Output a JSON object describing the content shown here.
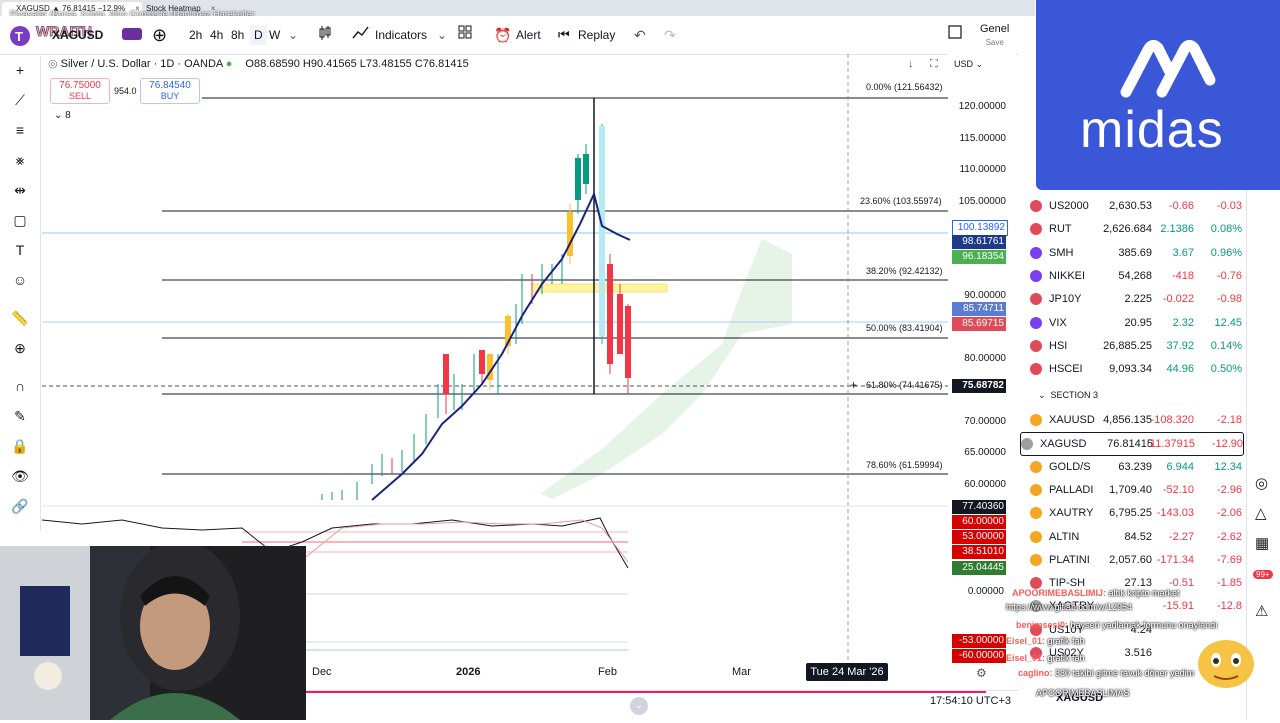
{
  "browser": {
    "tabs": [
      {
        "label": "XAGUSD ▲ 76.81415 −12.9%"
      },
      {
        "label": "Stock Heatmap"
      }
    ]
  },
  "overlay_text": "Piyasalar (Borsa, Kripto, Altın Gümüş'te (Hanlimaz Hareketler",
  "toolbar": {
    "symbol": "XAGUSD",
    "intervals": [
      "2h",
      "4h",
      "8h",
      "D",
      "W"
    ],
    "indicators": "Indicators",
    "alert": "Alert",
    "replay": "Replay",
    "layout_name": "Genel",
    "layout_sub": "Save"
  },
  "legend": {
    "title": "Silver / U.S. Dollar · 1D · OANDA",
    "open": "O88.68590",
    "high": "H90.41565",
    "low": "L73.48155",
    "close": "C76.81415",
    "sell_price": "76.75000",
    "sell_label": "SELL",
    "spread": "954.0",
    "buy_price": "76.84540",
    "buy_label": "BUY",
    "collapse_count": "8"
  },
  "price_axis": {
    "currency": "USD",
    "ticks": [
      "120.00000",
      "115.00000",
      "110.00000",
      "105.00000",
      "100.00000",
      "95.00000",
      "90.00000",
      "85.00000",
      "80.00000",
      "75.00000",
      "70.00000",
      "65.00000",
      "60.00000"
    ],
    "labels": [
      {
        "value": "100.13892",
        "color": "#ffffff",
        "text_color": "#2962ff"
      },
      {
        "value": "98.61761",
        "color": "#1e3a8a"
      },
      {
        "value": "96.18354",
        "color": "#4caf50"
      },
      {
        "value": "85.74711",
        "color": "#5b7bd5"
      },
      {
        "value": "85.69715",
        "color": "#e04b5a"
      },
      {
        "value": "75.68782",
        "color": "#131722"
      }
    ],
    "osc_labels": [
      {
        "value": "77.40360",
        "color": "#131722"
      },
      {
        "value": "60.00000",
        "color": "#d50000"
      },
      {
        "value": "53.00000",
        "color": "#d50000"
      },
      {
        "value": "38.51010",
        "color": "#d50000"
      },
      {
        "value": "25.04445",
        "color": "#2e7d32"
      },
      {
        "value": "0.00000",
        "color": "#ffffff",
        "text_color": "#131722"
      },
      {
        "value": "-53.00000",
        "color": "#d50000"
      },
      {
        "value": "-60.00000",
        "color": "#d50000"
      }
    ]
  },
  "fib": [
    {
      "label": "0.00% (121.56432)"
    },
    {
      "label": "23.60% (103.55974)"
    },
    {
      "label": "38.20% (92.42132)"
    },
    {
      "label": "50.00% (83.41904)"
    },
    {
      "label": "61.80% (74.41675)"
    },
    {
      "label": "78.60% (61.59994)"
    }
  ],
  "time_axis": {
    "labels": [
      "Dec",
      "2026",
      "Feb",
      "Mar"
    ],
    "crosshair": "Tue 24 Mar '26"
  },
  "clock": "17:54:10 UTC+3",
  "watchlist": {
    "rows": [
      {
        "sym": "US2000",
        "last": "2,630.53",
        "chg": "-0.66",
        "pct": "-0.03",
        "color": "#e04b5a"
      },
      {
        "sym": "RUT",
        "last": "2,626.684",
        "chg": "2.1386",
        "pct": "0.08%",
        "color": "#e04b5a"
      },
      {
        "sym": "SMH",
        "last": "385.69",
        "chg": "3.67",
        "pct": "0.96%",
        "color": "#7b3ff2"
      },
      {
        "sym": "NIKKEI",
        "last": "54,268",
        "chg": "-418",
        "pct": "-0.76",
        "color": "#7b3ff2"
      },
      {
        "sym": "JP10Y",
        "last": "2.225",
        "chg": "-0.022",
        "pct": "-0.98",
        "color": "#e04b5a"
      },
      {
        "sym": "VIX",
        "last": "20.95",
        "chg": "2.32",
        "pct": "12.45",
        "color": "#7b3ff2"
      },
      {
        "sym": "HSI",
        "last": "26,885.25",
        "chg": "37.92",
        "pct": "0.14%",
        "color": "#e04b5a"
      },
      {
        "sym": "HSCEI",
        "last": "9,093.34",
        "chg": "44.96",
        "pct": "0.50%",
        "color": "#e04b5a"
      }
    ],
    "section": "SECTION 3",
    "rows2": [
      {
        "sym": "XAUUSD",
        "last": "4,856.135",
        "chg": "-108.320",
        "pct": "-2.18",
        "color": "#f5a623"
      },
      {
        "sym": "XAGUSD",
        "last": "76.81415",
        "chg": "-11.37915",
        "pct": "-12.90",
        "color": "#9e9e9e"
      },
      {
        "sym": "GOLD/S",
        "last": "63.239",
        "chg": "6.944",
        "pct": "12.34",
        "color": "#f5a623"
      },
      {
        "sym": "PALLADI",
        "last": "1,709.40",
        "chg": "-52.10",
        "pct": "-2.96",
        "color": "#f5a623"
      },
      {
        "sym": "XAUTRY",
        "last": "6,795.25",
        "chg": "-143.03",
        "pct": "-2.06",
        "color": "#f5a623"
      },
      {
        "sym": "ALTIN",
        "last": "84.52",
        "chg": "-2.27",
        "pct": "-2.62",
        "color": "#f5a623"
      },
      {
        "sym": "PLATINI",
        "last": "2,057.60",
        "chg": "-171.34",
        "pct": "-7.69",
        "color": "#f5a623"
      },
      {
        "sym": "TIP-SH",
        "last": "27.13",
        "chg": "-0.51",
        "pct": "-1.85",
        "color": "#e04b5a"
      },
      {
        "sym": "XAGTRY",
        "last": "",
        "chg": "-15.91",
        "pct": "-12.8",
        "color": "#9e9e9e"
      },
      {
        "sym": "US10Y",
        "last": "4.24",
        "chg": "",
        "pct": "",
        "color": "#e04b5a"
      },
      {
        "sym": "US02Y",
        "last": "3.516",
        "chg": "",
        "pct": "-0.03",
        "color": "#e04b5a"
      }
    ],
    "footer_symbol": "XAGUSD"
  },
  "chat": [
    {
      "user": "APOORIMEBASLIMIJ:",
      "text": "altık kripto market"
    },
    {
      "user": "",
      "text": "https://www.gitlab.com/w/12954"
    },
    {
      "user": "benimsesi0:",
      "text": "bayseri yadlamak formunu onaylandı"
    },
    {
      "user": "Eisel_01:",
      "text": "grafik fah"
    },
    {
      "user": "Eisel_01:",
      "text": "grafik fah"
    },
    {
      "user": "caglino:",
      "text": "330 takibi gitme tavuk döner yedim"
    },
    {
      "user": "",
      "text": "APOORIMEBASLIMAS"
    }
  ],
  "brand": {
    "name": "midas"
  },
  "notification_badge": "99+"
}
